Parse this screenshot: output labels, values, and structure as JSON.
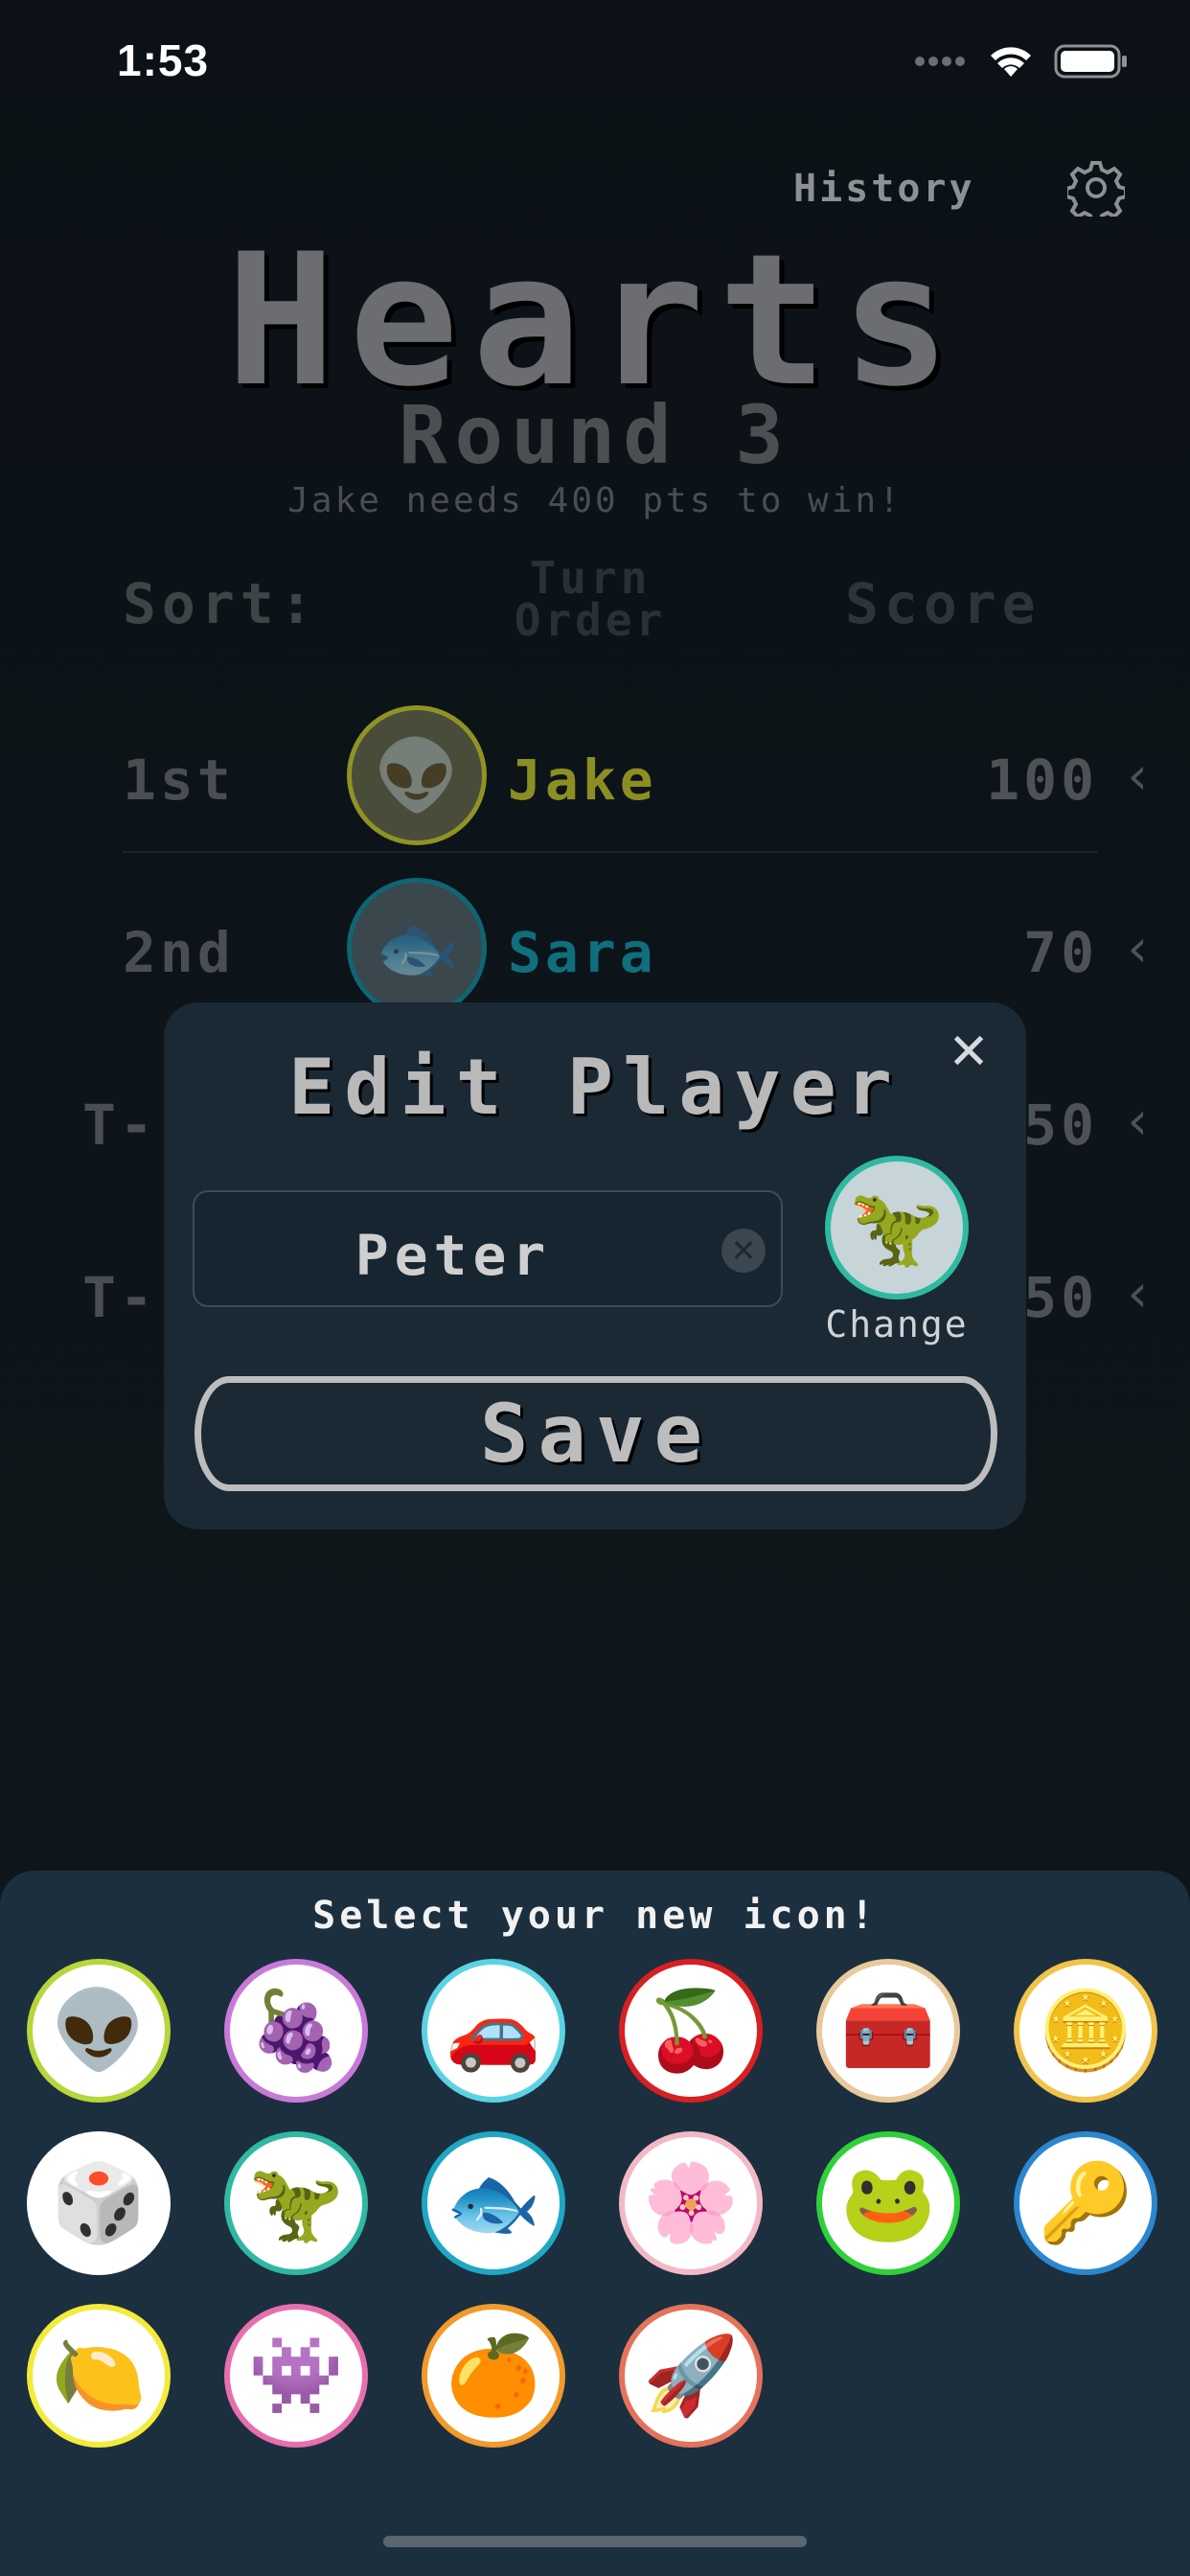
{
  "status_bar": {
    "time": "1:53"
  },
  "header": {
    "history_label": "History",
    "title": "Hearts",
    "round_label": "Round 3",
    "win_text": "Jake needs 400 pts to win!"
  },
  "sort": {
    "label": "Sort:",
    "turn_order": "Turn Order",
    "score": "Score"
  },
  "players": [
    {
      "rank": "1st",
      "name": "Jake",
      "score": "100",
      "color": "#8b8f23",
      "ring": "#8f9323",
      "avatar": "alien-icon",
      "glyph": "👽"
    },
    {
      "rank": "2nd",
      "name": "Sara",
      "score": "70",
      "color": "#0f6f7c",
      "ring": "#0f6672",
      "avatar": "fish-icon",
      "glyph": "🐟"
    },
    {
      "rank": "T-",
      "name": "",
      "score": "50",
      "color": "#4a4e52",
      "ring": "#333",
      "avatar": "",
      "glyph": ""
    },
    {
      "rank": "T-",
      "name": "",
      "score": "50",
      "color": "#4a4e52",
      "ring": "#333",
      "avatar": "",
      "glyph": ""
    }
  ],
  "modal": {
    "title": "Edit Player",
    "name_value": "Peter",
    "change_label": "Change",
    "save_label": "Save",
    "current_icon": "dinosaur-icon"
  },
  "icon_sheet": {
    "title": "Select your new icon!",
    "icons": [
      {
        "name": "alien-icon",
        "glyph": "👽",
        "border": "#b6d63a"
      },
      {
        "name": "grapes-icon",
        "glyph": "🍇",
        "border": "#c77ad8"
      },
      {
        "name": "car-icon",
        "glyph": "🚗",
        "border": "#5bd3e3"
      },
      {
        "name": "cherries-icon",
        "glyph": "🍒",
        "border": "#d81f22"
      },
      {
        "name": "treasure-chest-icon",
        "glyph": "🧰",
        "border": "#e8c99c"
      },
      {
        "name": "coin-icon",
        "glyph": "🪙",
        "border": "#f1c34a"
      },
      {
        "name": "dice-icon",
        "glyph": "🎲",
        "border": "#ffffff"
      },
      {
        "name": "dinosaur-icon",
        "glyph": "🦖",
        "border": "#2fb9a2"
      },
      {
        "name": "fish-icon",
        "glyph": "🐟",
        "border": "#1fa7c4"
      },
      {
        "name": "flower-icon",
        "glyph": "🌸",
        "border": "#f3b8c6"
      },
      {
        "name": "frog-icon",
        "glyph": "🐸",
        "border": "#2fd13a"
      },
      {
        "name": "key-icon",
        "glyph": "🔑",
        "border": "#2b87cf"
      },
      {
        "name": "lemon-icon",
        "glyph": "🍋",
        "border": "#f3eb3c"
      },
      {
        "name": "pink-monster-icon",
        "glyph": "👾",
        "border": "#e76fad"
      },
      {
        "name": "orange-icon",
        "glyph": "🍊",
        "border": "#f29a2a"
      },
      {
        "name": "rocket-icon",
        "glyph": "🚀",
        "border": "#e4735c"
      }
    ]
  }
}
